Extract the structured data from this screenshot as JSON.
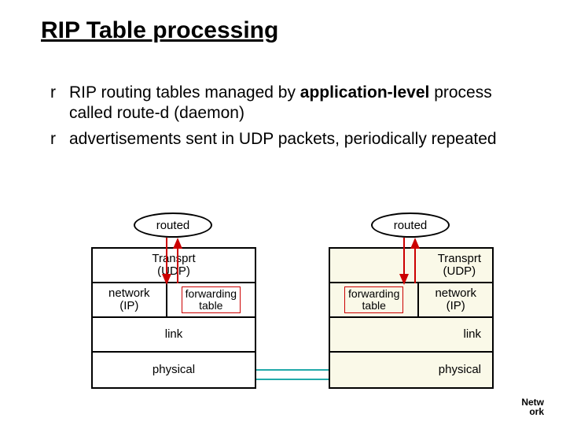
{
  "title": "RIP Table processing",
  "bullets": [
    {
      "marker": "r",
      "pre": "RIP routing tables managed by ",
      "bold": "application-level",
      "post": "process called route-d (daemon)"
    },
    {
      "marker": "r",
      "pre": "advertisements sent in UDP packets, periodically repeated",
      "bold": "",
      "post": ""
    }
  ],
  "ellipse": {
    "left": "routed",
    "right": "routed"
  },
  "left_stack": {
    "transport": "Transprt\n(UDP)",
    "network": "network\n(IP)",
    "fwd": "forwarding\ntable",
    "link": "link",
    "physical": "physical"
  },
  "right_stack": {
    "transport": "Transprt\n(UDP)",
    "network": "network\n(IP)",
    "fwd": "forwarding\ntable",
    "link": "link",
    "physical": "physical"
  },
  "footer": {
    "l1": "Netw",
    "l2": "ork"
  }
}
